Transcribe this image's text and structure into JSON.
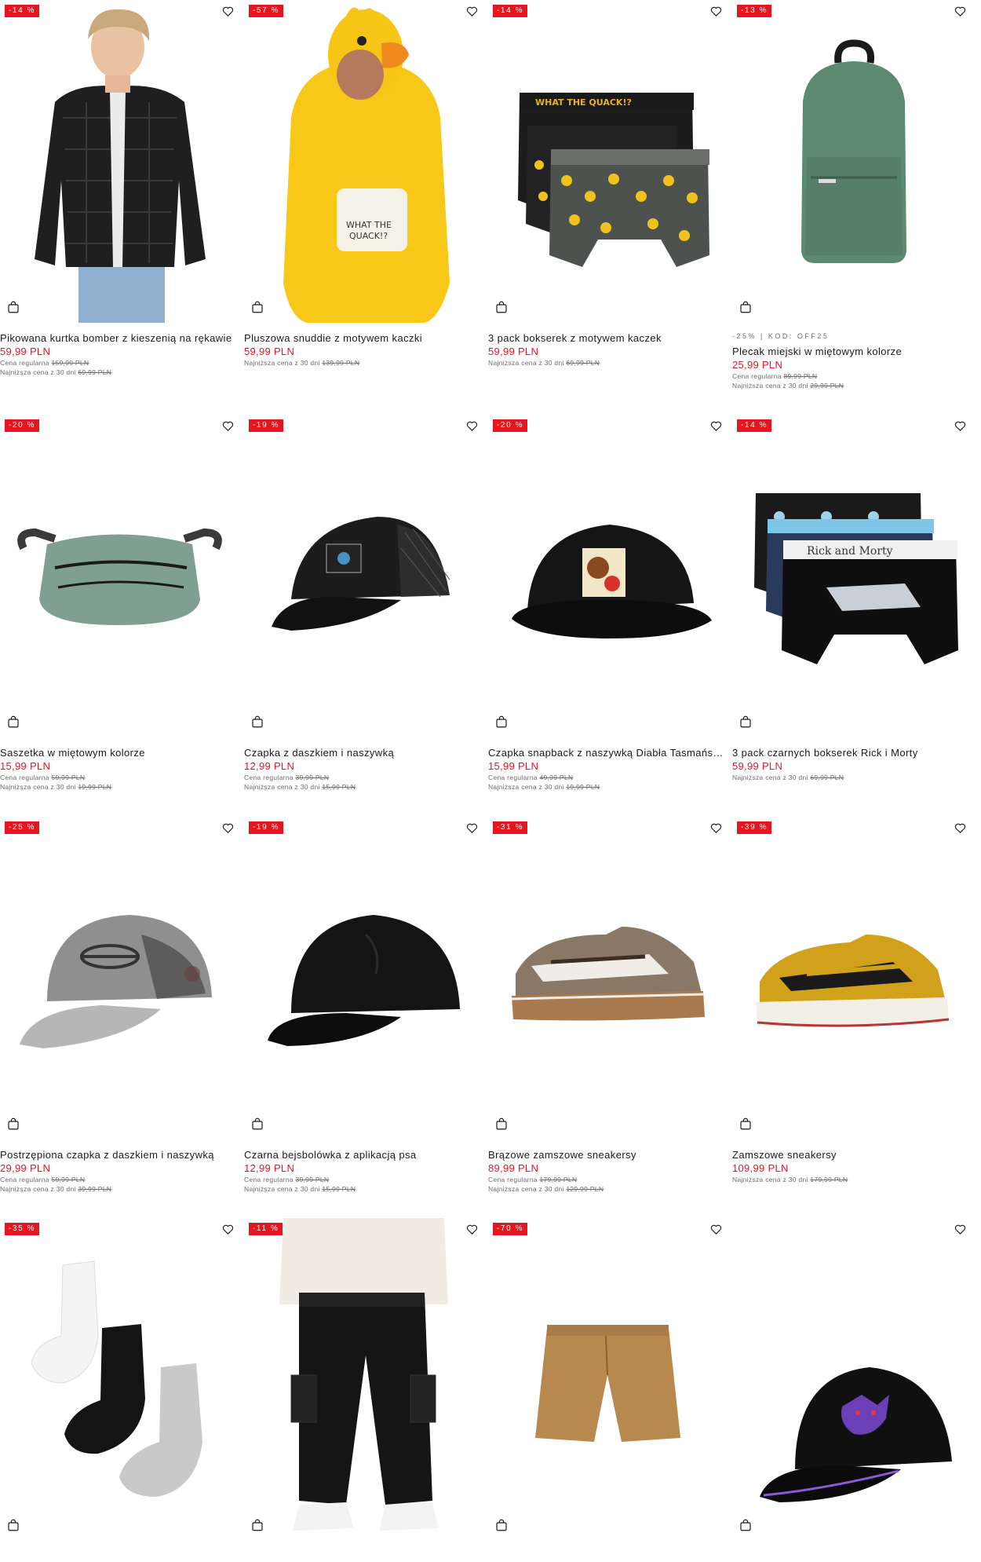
{
  "products": [
    {
      "title": "Pikowana kurtka bomber z kieszenią na rękawie",
      "price": "59,99 PLN",
      "badge": "-14 %",
      "promo": "",
      "regular_label": "Cena regularna",
      "regular_price": "159,99 PLN",
      "lowest_label": "Najniższa cena z 30 dni",
      "lowest_price": "69,99 PLN",
      "image": "bomber-jacket"
    },
    {
      "title": "Pluszowa snuddie z motywem kaczki",
      "price": "59,99 PLN",
      "badge": "-57 %",
      "promo": "",
      "regular_label": "",
      "regular_price": "",
      "lowest_label": "Najniższa cena z 30 dni",
      "lowest_price": "139,99 PLN",
      "image": "duck-hoodie"
    },
    {
      "title": "3 pack bokserek z motywem kaczek",
      "price": "59,99 PLN",
      "badge": "-14 %",
      "promo": "",
      "regular_label": "",
      "regular_price": "",
      "lowest_label": "Najniższa cena z 30 dni",
      "lowest_price": "69,99 PLN",
      "image": "duck-boxers"
    },
    {
      "title": "Plecak miejski w miętowym kolorze",
      "price": "25,99 PLN",
      "badge": "-13 %",
      "promo": "-25% | KOD: OFF25",
      "regular_label": "Cena regularna",
      "regular_price": "89,99 PLN",
      "lowest_label": "Najniższa cena z 30 dni",
      "lowest_price": "29,99 PLN",
      "image": "mint-backpack"
    },
    {
      "title": "Saszetka w miętowym kolorze",
      "price": "15,99 PLN",
      "badge": "-20 %",
      "promo": "",
      "regular_label": "Cena regularna",
      "regular_price": "59,99 PLN",
      "lowest_label": "Najniższa cena z 30 dni",
      "lowest_price": "19,99 PLN",
      "image": "mint-waistbag"
    },
    {
      "title": "Czapka z daszkiem i naszywką",
      "price": "12,99 PLN",
      "badge": "-19 %",
      "promo": "",
      "regular_label": "Cena regularna",
      "regular_price": "39,99 PLN",
      "lowest_label": "Najniższa cena z 30 dni",
      "lowest_price": "15,99 PLN",
      "image": "trucker-cap"
    },
    {
      "title": "Czapka snapback z naszywką Diabła Tasmańskiego",
      "price": "15,99 PLN",
      "badge": "-20 %",
      "promo": "",
      "regular_label": "Cena regularna",
      "regular_price": "49,99 PLN",
      "lowest_label": "Najniższa cena z 30 dni",
      "lowest_price": "19,99 PLN",
      "image": "snapback-taz"
    },
    {
      "title": "3 pack czarnych bokserek Rick i Morty",
      "price": "59,99 PLN",
      "badge": "-14 %",
      "promo": "",
      "regular_label": "",
      "regular_price": "",
      "lowest_label": "Najniższa cena z 30 dni",
      "lowest_price": "69,99 PLN",
      "image": "rick-morty-boxers"
    },
    {
      "title": "Postrzępiona czapka z daszkiem i naszywką",
      "price": "29,99 PLN",
      "badge": "-25 %",
      "promo": "",
      "regular_label": "Cena regularna",
      "regular_price": "59,99 PLN",
      "lowest_label": "Najniższa cena z 30 dni",
      "lowest_price": "39,99 PLN",
      "image": "distressed-cap"
    },
    {
      "title": "Czarna bejsbolówka z aplikacją psa",
      "price": "12,99 PLN",
      "badge": "-19 %",
      "promo": "",
      "regular_label": "Cena regularna",
      "regular_price": "39,99 PLN",
      "lowest_label": "Najniższa cena z 30 dni",
      "lowest_price": "15,99 PLN",
      "image": "black-baseball-cap"
    },
    {
      "title": "Brązowe zamszowe sneakersy",
      "price": "89,99 PLN",
      "badge": "-31 %",
      "promo": "",
      "regular_label": "Cena regularna",
      "regular_price": "179,99 PLN",
      "lowest_label": "Najniższa cena z 30 dni",
      "lowest_price": "129,99 PLN",
      "image": "brown-sneakers"
    },
    {
      "title": "Zamszowe sneakersy",
      "price": "109,99 PLN",
      "badge": "-39 %",
      "promo": "",
      "regular_label": "",
      "regular_price": "",
      "lowest_label": "Najniższa cena z 30 dni",
      "lowest_price": "179,99 PLN",
      "image": "yellow-sneakers"
    },
    {
      "title": "",
      "price": "",
      "badge": "-35 %",
      "promo": "",
      "regular_label": "",
      "regular_price": "",
      "lowest_label": "",
      "lowest_price": "",
      "image": "socks-3pack"
    },
    {
      "title": "",
      "price": "",
      "badge": "-11 %",
      "promo": "",
      "regular_label": "",
      "regular_price": "",
      "lowest_label": "",
      "lowest_price": "",
      "image": "cargo-joggers"
    },
    {
      "title": "",
      "price": "",
      "badge": "-70 %",
      "promo": "",
      "regular_label": "",
      "regular_price": "",
      "lowest_label": "",
      "lowest_price": "",
      "image": "chino-shorts"
    },
    {
      "title": "",
      "price": "",
      "badge": "",
      "promo": "",
      "regular_label": "",
      "regular_price": "",
      "lowest_label": "",
      "lowest_price": "",
      "image": "gengar-cap"
    }
  ],
  "icons": {
    "wishlist": "heart-icon",
    "add_to_cart": "shopping-bag-icon"
  },
  "colors": {
    "sale_red": "#e4161f",
    "text": "#1a1a1a",
    "muted": "#6b6b6b"
  }
}
